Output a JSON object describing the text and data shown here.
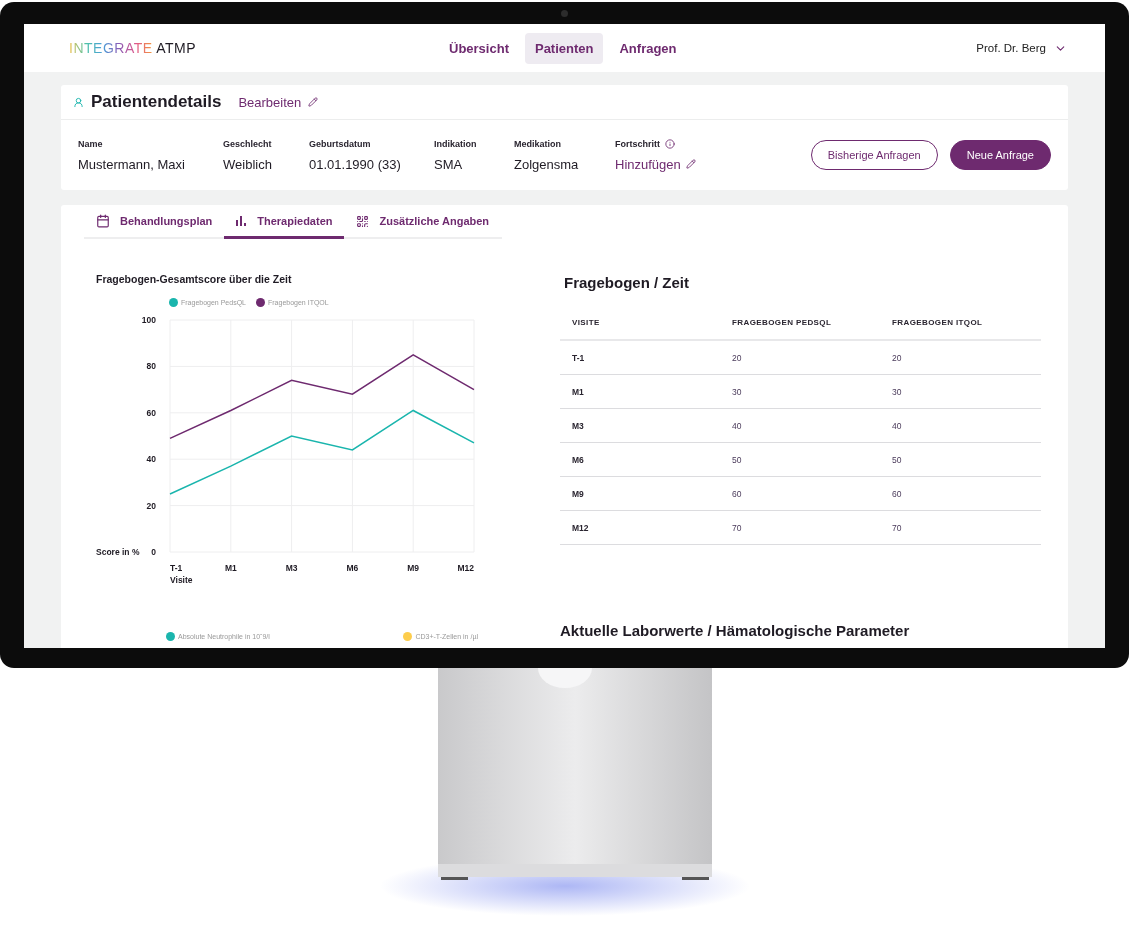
{
  "header": {
    "logo": {
      "first": "INTEGRATE",
      "second": "ATMP"
    },
    "nav": [
      {
        "label": "Übersicht",
        "selected": false
      },
      {
        "label": "Patienten",
        "selected": true
      },
      {
        "label": "Anfragen",
        "selected": false
      }
    ],
    "user": "Prof. Dr. Berg"
  },
  "patient": {
    "title": "Patientendetails",
    "edit": "Bearbeiten",
    "fields": [
      {
        "label": "Name",
        "value": "Mustermann, Maxi",
        "kind": "text",
        "info": false
      },
      {
        "label": "Geschlecht",
        "value": "Weiblich",
        "kind": "text",
        "info": false
      },
      {
        "label": "Geburtsdatum",
        "value": "01.01.1990 (33)",
        "kind": "text",
        "info": false
      },
      {
        "label": "Indikation",
        "value": "SMA",
        "kind": "text",
        "info": false
      },
      {
        "label": "Medikation",
        "value": "Zolgensma",
        "kind": "text",
        "info": false
      },
      {
        "label": "Fortschritt",
        "value": "Hinzufügen",
        "kind": "link",
        "info": true
      }
    ],
    "buttons": [
      {
        "label": "Bisherige Anfragen",
        "kind": "outline"
      },
      {
        "label": "Neue Anfrage",
        "kind": "primary"
      }
    ]
  },
  "tabs": [
    {
      "label": "Behandlungsplan",
      "kind": "calendar",
      "selected": false
    },
    {
      "label": "Therapiedaten",
      "kind": "chart",
      "selected": true
    },
    {
      "label": "Zusätzliche Angaben",
      "kind": "qr",
      "selected": false
    }
  ],
  "chart": {
    "title": "Fragebogen-Gesamtscore über die Zeit",
    "chart_data": {
      "type": "line",
      "xlabel": "Visite",
      "ylabel": "Score in %",
      "categories": [
        "T-1",
        "M1",
        "M3",
        "M6",
        "M9",
        "M12"
      ],
      "series": [
        {
          "name": "Fragebogen PedsQL",
          "color": "#1ab5ad",
          "values": [
            25,
            37,
            50,
            44,
            61,
            47
          ]
        },
        {
          "name": "Fragebogen ITQOL",
          "color": "#6e2a6f",
          "values": [
            49,
            61,
            74,
            68,
            85,
            70
          ]
        }
      ],
      "ylim": [
        0,
        100
      ],
      "yticks": [
        0,
        20,
        40,
        60,
        80,
        100
      ],
      "grid": true
    }
  },
  "table": {
    "title": "Fragebogen / Zeit",
    "columns": [
      "VISITE",
      "FRAGEBOGEN PEDSQL",
      "FRAGEBOGEN ITQOL"
    ],
    "rows": [
      [
        "T-1",
        "20",
        "20"
      ],
      [
        "M1",
        "30",
        "30"
      ],
      [
        "M3",
        "40",
        "40"
      ],
      [
        "M6",
        "50",
        "50"
      ],
      [
        "M9",
        "60",
        "60"
      ],
      [
        "M12",
        "70",
        "70"
      ]
    ]
  },
  "lab_legend": [
    {
      "label": "Absolute Neutrophile in 10ˆ9/l",
      "color": "#1ab5ad"
    },
    {
      "label": "CD3+-T-Zellen in /µl",
      "color": "#fdcd4c"
    }
  ],
  "lab_title": "Aktuelle Laborwerte / Hämatologische Parameter"
}
